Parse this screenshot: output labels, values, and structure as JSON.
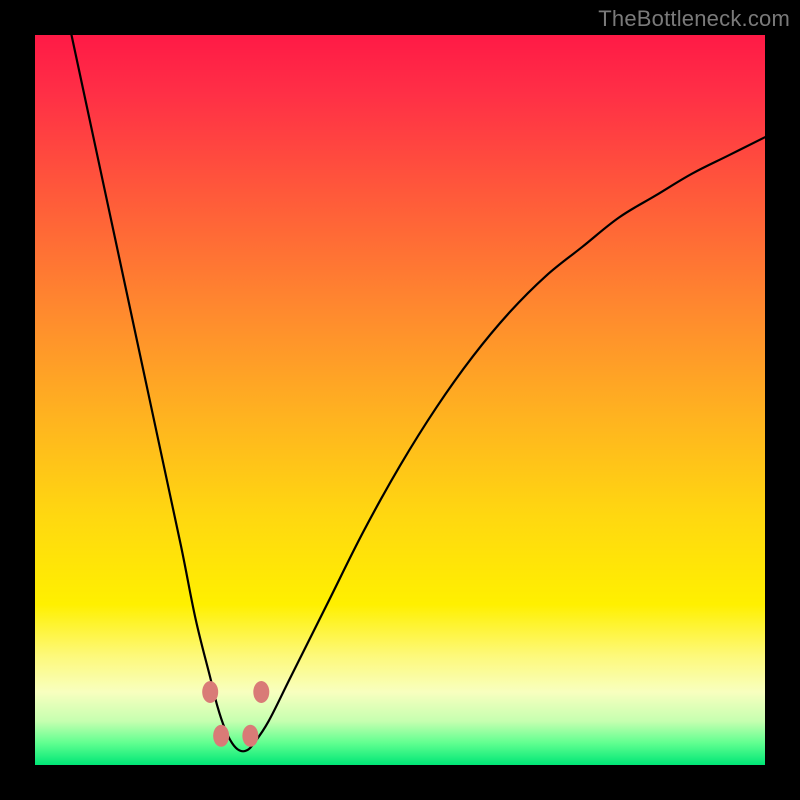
{
  "watermark": "TheBottleneck.com",
  "chart_data": {
    "type": "line",
    "title": "",
    "xlabel": "",
    "ylabel": "",
    "xlim": [
      0,
      100
    ],
    "ylim": [
      0,
      100
    ],
    "series": [
      {
        "name": "bottleneck-curve",
        "x": [
          5,
          8,
          11,
          14,
          17,
          20,
          22,
          24,
          25,
          26,
          27,
          28,
          29,
          30,
          32,
          35,
          40,
          45,
          50,
          55,
          60,
          65,
          70,
          75,
          80,
          85,
          90,
          95,
          100
        ],
        "y": [
          100,
          86,
          72,
          58,
          44,
          30,
          20,
          12,
          8,
          5,
          3,
          2,
          2,
          3,
          6,
          12,
          22,
          32,
          41,
          49,
          56,
          62,
          67,
          71,
          75,
          78,
          81,
          83.5,
          86
        ]
      }
    ],
    "markers": [
      {
        "name": "marker-left-upper",
        "x": 24.0,
        "y": 10,
        "color": "#d97b77"
      },
      {
        "name": "marker-left-lower",
        "x": 25.5,
        "y": 4,
        "color": "#d97b77"
      },
      {
        "name": "marker-right-lower",
        "x": 29.5,
        "y": 4,
        "color": "#d97b77"
      },
      {
        "name": "marker-right-upper",
        "x": 31.0,
        "y": 10,
        "color": "#d97b77"
      }
    ],
    "gradient_stops": [
      {
        "pos": 0.0,
        "color": "#ff1a46"
      },
      {
        "pos": 0.4,
        "color": "#ff8a2e"
      },
      {
        "pos": 0.78,
        "color": "#fff000"
      },
      {
        "pos": 0.94,
        "color": "#c6ffb0"
      },
      {
        "pos": 1.0,
        "color": "#00e676"
      }
    ]
  }
}
